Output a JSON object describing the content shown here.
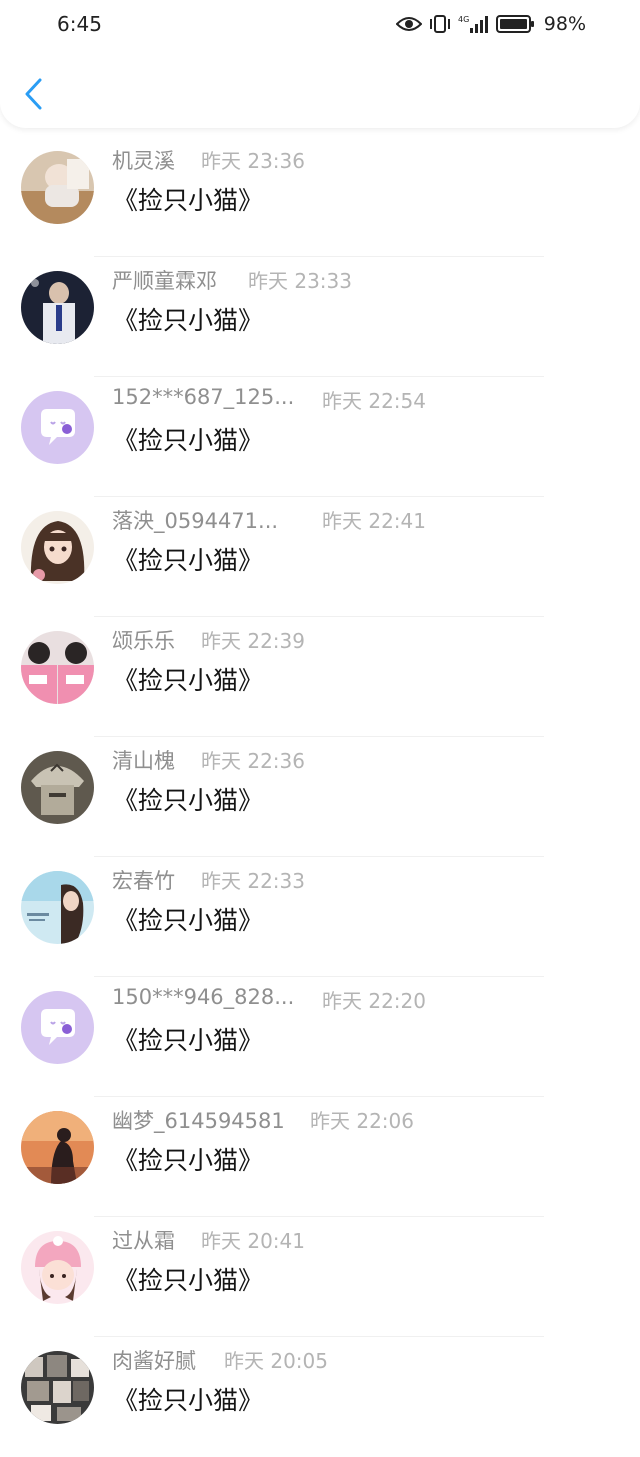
{
  "status_bar": {
    "time": "6:45",
    "battery": "98%"
  },
  "nav": {
    "back_icon": "chevron-left-icon",
    "accent_color": "#2a9df4"
  },
  "items": [
    {
      "name": "机灵溪",
      "time": "昨天 23:36",
      "message": "《捡只小猫》",
      "avatar": "photo"
    },
    {
      "name": "严顺童霖邓",
      "time": "昨天 23:33",
      "message": "《捡只小猫》",
      "avatar": "photo"
    },
    {
      "name": "152***687_125...",
      "time": "昨天 22:54",
      "message": "《捡只小猫》",
      "avatar": "default-chat-bubble"
    },
    {
      "name": "落泱_0594471...",
      "time": "昨天 22:41",
      "message": "《捡只小猫》",
      "avatar": "photo"
    },
    {
      "name": "颂乐乐",
      "time": "昨天 22:39",
      "message": "《捡只小猫》",
      "avatar": "photo"
    },
    {
      "name": "清山槐",
      "time": "昨天 22:36",
      "message": "《捡只小猫》",
      "avatar": "photo"
    },
    {
      "name": "宏春竹",
      "time": "昨天 22:33",
      "message": "《捡只小猫》",
      "avatar": "photo"
    },
    {
      "name": "150***946_828...",
      "time": "昨天 22:20",
      "message": "《捡只小猫》",
      "avatar": "default-chat-bubble"
    },
    {
      "name": "幽梦_614594581",
      "time": "昨天 22:06",
      "message": "《捡只小猫》",
      "avatar": "photo"
    },
    {
      "name": "过从霜",
      "time": "昨天 20:41",
      "message": "《捡只小猫》",
      "avatar": "photo"
    },
    {
      "name": "肉酱好腻",
      "time": "昨天 20:05",
      "message": "《捡只小猫》",
      "avatar": "photo"
    }
  ]
}
